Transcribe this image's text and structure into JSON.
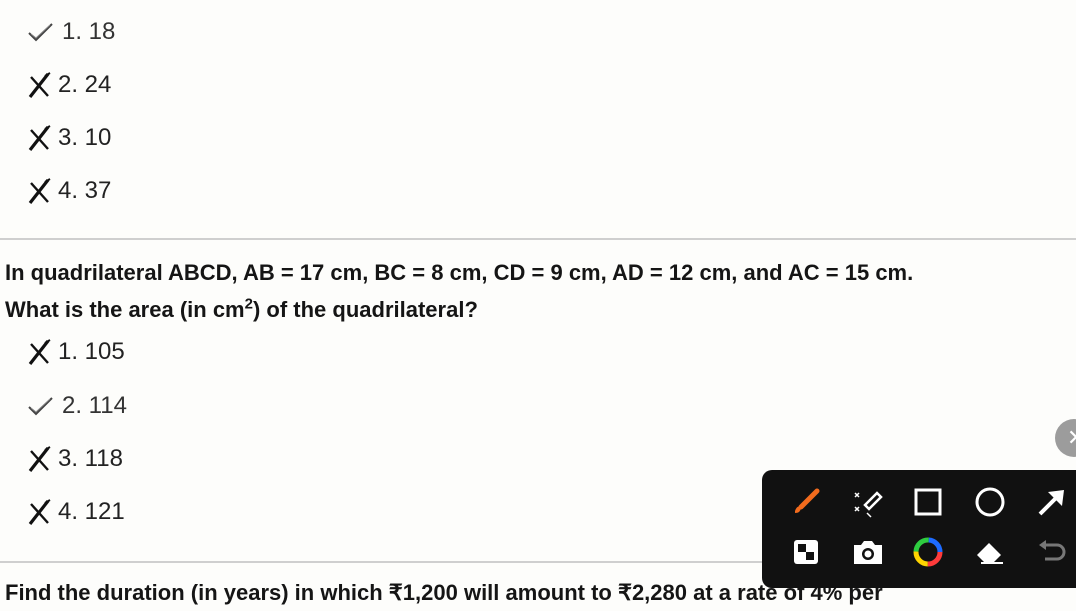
{
  "previous_question": {
    "options": [
      {
        "label": "1. 18",
        "status": "correct"
      },
      {
        "label": "2. 24",
        "status": "wrong"
      },
      {
        "label": "3. 10",
        "status": "wrong"
      },
      {
        "label": "4. 37",
        "status": "wrong"
      }
    ]
  },
  "question_main": {
    "line1": "In quadrilateral ABCD, AB = 17 cm, BC = 8 cm, CD = 9 cm, AD = 12 cm, and AC = 15 cm.",
    "line2_pre": "What is the area (in cm",
    "line2_sup": "2",
    "line2_post": ") of the quadrilateral?",
    "options": [
      {
        "label": "1. 105",
        "status": "wrong"
      },
      {
        "label": "2. 114",
        "status": "correct"
      },
      {
        "label": "3. 118",
        "status": "wrong"
      },
      {
        "label": "4. 121",
        "status": "wrong"
      }
    ]
  },
  "next_question": {
    "line1": "Find the duration (in years) in which ₹1,200 will amount to ₹2,280 at a rate of 4% per"
  },
  "toolbar": {
    "tools": [
      "brush-icon",
      "highlighter-icon",
      "rectangle-icon",
      "circle-icon",
      "arrow-icon",
      "whiteboard-icon",
      "screenshot-icon",
      "color-picker-icon",
      "eraser-icon",
      "undo-icon"
    ],
    "brush_color": "#f26b1d"
  }
}
